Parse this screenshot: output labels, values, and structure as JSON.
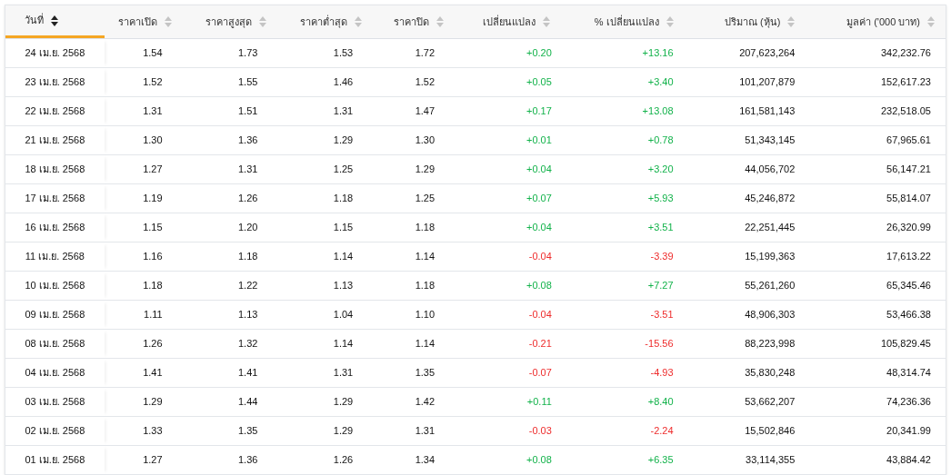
{
  "table": {
    "columns": [
      {
        "label": "วันที่",
        "selected": true
      },
      {
        "label": "ราคาเปิด",
        "selected": false
      },
      {
        "label": "ราคาสูงสุด",
        "selected": false
      },
      {
        "label": "ราคาต่ำสุด",
        "selected": false
      },
      {
        "label": "ราคาปิด",
        "selected": false
      },
      {
        "label": "เปลี่ยนแปลง",
        "selected": false
      },
      {
        "label": "% เปลี่ยนแปลง",
        "selected": false
      },
      {
        "label": "ปริมาณ (หุ้น)",
        "selected": false
      },
      {
        "label": "มูลค่า ('000 บาท)",
        "selected": false
      }
    ],
    "rows": [
      {
        "kind": "up",
        "cells": [
          "24 เม.ย. 2568",
          "1.54",
          "1.73",
          "1.53",
          "1.72",
          "+0.20",
          "+13.16",
          "207,623,264",
          "342,232.76"
        ]
      },
      {
        "kind": "up",
        "cells": [
          "23 เม.ย. 2568",
          "1.52",
          "1.55",
          "1.46",
          "1.52",
          "+0.05",
          "+3.40",
          "101,207,879",
          "152,617.23"
        ]
      },
      {
        "kind": "up",
        "cells": [
          "22 เม.ย. 2568",
          "1.31",
          "1.51",
          "1.31",
          "1.47",
          "+0.17",
          "+13.08",
          "161,581,143",
          "232,518.05"
        ]
      },
      {
        "kind": "up",
        "cells": [
          "21 เม.ย. 2568",
          "1.30",
          "1.36",
          "1.29",
          "1.30",
          "+0.01",
          "+0.78",
          "51,343,145",
          "67,965.61"
        ]
      },
      {
        "kind": "up",
        "cells": [
          "18 เม.ย. 2568",
          "1.27",
          "1.31",
          "1.25",
          "1.29",
          "+0.04",
          "+3.20",
          "44,056,702",
          "56,147.21"
        ]
      },
      {
        "kind": "up",
        "cells": [
          "17 เม.ย. 2568",
          "1.19",
          "1.26",
          "1.18",
          "1.25",
          "+0.07",
          "+5.93",
          "45,246,872",
          "55,814.07"
        ]
      },
      {
        "kind": "up",
        "cells": [
          "16 เม.ย. 2568",
          "1.15",
          "1.20",
          "1.15",
          "1.18",
          "+0.04",
          "+3.51",
          "22,251,445",
          "26,320.99"
        ]
      },
      {
        "kind": "down",
        "cells": [
          "11 เม.ย. 2568",
          "1.16",
          "1.18",
          "1.14",
          "1.14",
          "-0.04",
          "-3.39",
          "15,199,363",
          "17,613.22"
        ]
      },
      {
        "kind": "up",
        "cells": [
          "10 เม.ย. 2568",
          "1.18",
          "1.22",
          "1.13",
          "1.18",
          "+0.08",
          "+7.27",
          "55,261,260",
          "65,345.46"
        ]
      },
      {
        "kind": "down",
        "cells": [
          "09 เม.ย. 2568",
          "1.11",
          "1.13",
          "1.04",
          "1.10",
          "-0.04",
          "-3.51",
          "48,906,303",
          "53,466.38"
        ]
      },
      {
        "kind": "down",
        "cells": [
          "08 เม.ย. 2568",
          "1.26",
          "1.32",
          "1.14",
          "1.14",
          "-0.21",
          "-15.56",
          "88,223,998",
          "105,829.45"
        ]
      },
      {
        "kind": "down",
        "cells": [
          "04 เม.ย. 2568",
          "1.41",
          "1.41",
          "1.31",
          "1.35",
          "-0.07",
          "-4.93",
          "35,830,248",
          "48,314.74"
        ]
      },
      {
        "kind": "up",
        "cells": [
          "03 เม.ย. 2568",
          "1.29",
          "1.44",
          "1.29",
          "1.42",
          "+0.11",
          "+8.40",
          "53,662,207",
          "74,236.36"
        ]
      },
      {
        "kind": "down",
        "cells": [
          "02 เม.ย. 2568",
          "1.33",
          "1.35",
          "1.29",
          "1.31",
          "-0.03",
          "-2.24",
          "15,502,846",
          "20,341.99"
        ]
      },
      {
        "kind": "up",
        "cells": [
          "01 เม.ย. 2568",
          "1.27",
          "1.36",
          "1.26",
          "1.34",
          "+0.08",
          "+6.35",
          "33,114,355",
          "43,884.42"
        ]
      }
    ]
  }
}
